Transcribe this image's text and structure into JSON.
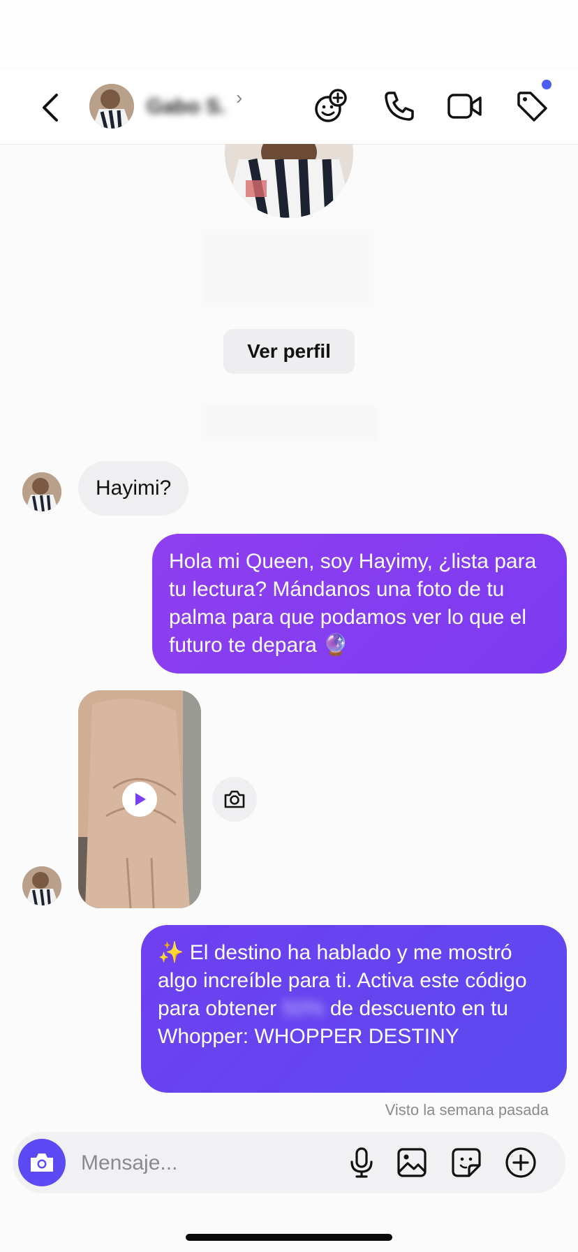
{
  "header": {
    "contact_name": "Gabo S.",
    "chevron": "›"
  },
  "profile": {
    "view_profile_label": "Ver perfil"
  },
  "messages": [
    {
      "direction": "incoming",
      "text": "Hayimi?"
    },
    {
      "direction": "outgoing",
      "text": "Hola mi Queen, soy Hayimy, ¿lista para tu lectura?  Mándanos una foto de tu palma para que podamos ver lo que el futuro te depara 🔮"
    },
    {
      "direction": "incoming",
      "type": "video",
      "icon": "play-icon"
    },
    {
      "direction": "outgoing",
      "text_before": "✨ El destino ha hablado y me mostró algo increíble para ti. Activa este código para obtener ",
      "blurred": "50%",
      "text_after": " de descuento en tu Whopper: WHOPPER DESTINY"
    }
  ],
  "status": {
    "seen": "Visto la semana pasada"
  },
  "composer": {
    "placeholder": "Mensaje..."
  },
  "colors": {
    "accent": "#5e4af5",
    "bubble_purple": "#8f3ff0",
    "bubble_indigo": "#5b4af0",
    "notification_dot": "#4a5cf2"
  }
}
